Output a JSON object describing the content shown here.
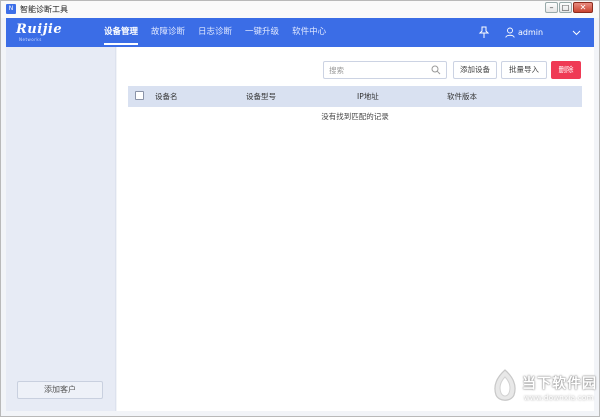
{
  "window": {
    "title": "智能诊断工具",
    "icon_letter": "N",
    "minimize_glyph": "–",
    "maximize_glyph": "□",
    "close_glyph": "✕"
  },
  "header": {
    "logo": "Ruijie",
    "logo_sub": "Networks",
    "nav": [
      {
        "label": "设备管理",
        "active": true
      },
      {
        "label": "故障诊断",
        "active": false
      },
      {
        "label": "日志诊断",
        "active": false
      },
      {
        "label": "一键升级",
        "active": false
      },
      {
        "label": "软件中心",
        "active": false
      }
    ],
    "username": "admin",
    "icons": [
      "pin-icon",
      "user-icon",
      "chevron-down-icon"
    ]
  },
  "sidebar": {
    "add_customer_label": "添加客户"
  },
  "toolbar": {
    "search_placeholder": "搜索",
    "add_device_label": "添加设备",
    "batch_import_label": "批量导入",
    "delete_label": "删除"
  },
  "table": {
    "columns": [
      "设备名",
      "设备型号",
      "IP地址",
      "软件版本"
    ],
    "empty_text": "没有找到匹配的记录"
  },
  "watermark": {
    "text": "当下软件园",
    "url": "www.downxia.com"
  },
  "colors": {
    "accent": "#3b6de6",
    "danger": "#ef3a55",
    "sidebar_bg": "#e7ebf5",
    "table_head_bg": "#d9e1f1"
  }
}
